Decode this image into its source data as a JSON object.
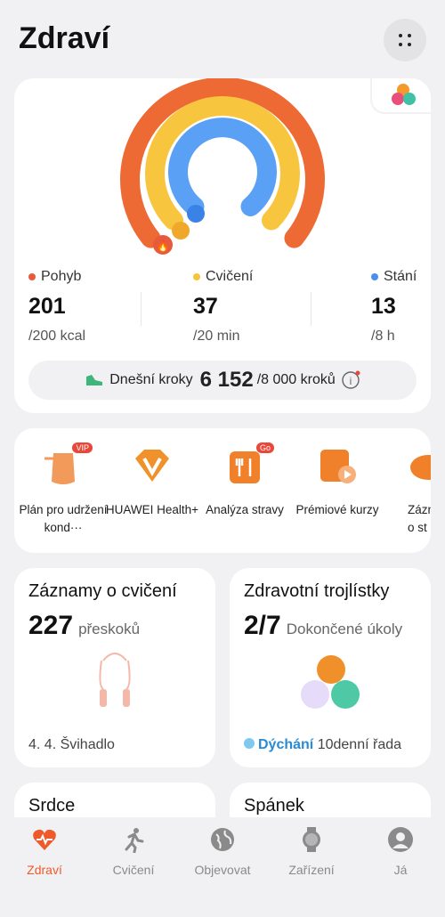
{
  "header": {
    "title": "Zdraví"
  },
  "activity": {
    "stats": [
      {
        "label": "Pohyb",
        "value": "201",
        "target": "/200 kcal",
        "color": "#e85a3c"
      },
      {
        "label": "Cvičení",
        "value": "37",
        "target": "/20 min",
        "color": "#f5c43a"
      },
      {
        "label": "Stání",
        "value": "13",
        "target": "/8 h",
        "color": "#4a8ef0"
      }
    ],
    "steps": {
      "label": "Dnešní kroky",
      "value": "6 152",
      "target": "/8 000 kroků"
    },
    "ring_progress": {
      "move": 1.0,
      "exercise": 1.0,
      "stand": 1.0
    }
  },
  "services": [
    {
      "label": "Plán pro udržení kond···",
      "badge": "VIP"
    },
    {
      "label": "HUAWEI Health+",
      "badge": ""
    },
    {
      "label": "Analýza stravy",
      "badge": "Go"
    },
    {
      "label": "Prémiové kurzy",
      "badge": ""
    },
    {
      "label": "Zázn o st",
      "badge": ""
    }
  ],
  "tiles": {
    "exercise": {
      "title": "Záznamy o cvičení",
      "value": "227",
      "unit": "přeskoků",
      "footer": "4. 4. Švihadlo"
    },
    "clovers": {
      "title": "Zdravotní trojlístky",
      "value": "2/7",
      "unit": "Dokončené úkoly",
      "footer_highlight": "Dýchání",
      "footer": "10denní řada"
    },
    "heart": {
      "title": "Srdce"
    },
    "sleep": {
      "title": "Spánek"
    }
  },
  "tabs": [
    {
      "label": "Zdraví",
      "icon": "heart-icon",
      "active": true
    },
    {
      "label": "Cvičení",
      "icon": "running-icon",
      "active": false
    },
    {
      "label": "Objevovat",
      "icon": "globe-icon",
      "active": false
    },
    {
      "label": "Zařízení",
      "icon": "watch-icon",
      "active": false
    },
    {
      "label": "Já",
      "icon": "profile-icon",
      "active": false
    }
  ],
  "colors": {
    "accent": "#ef5a2a",
    "move": "#e85a3c",
    "exercise": "#f5c43a",
    "stand": "#4a8ef0"
  }
}
